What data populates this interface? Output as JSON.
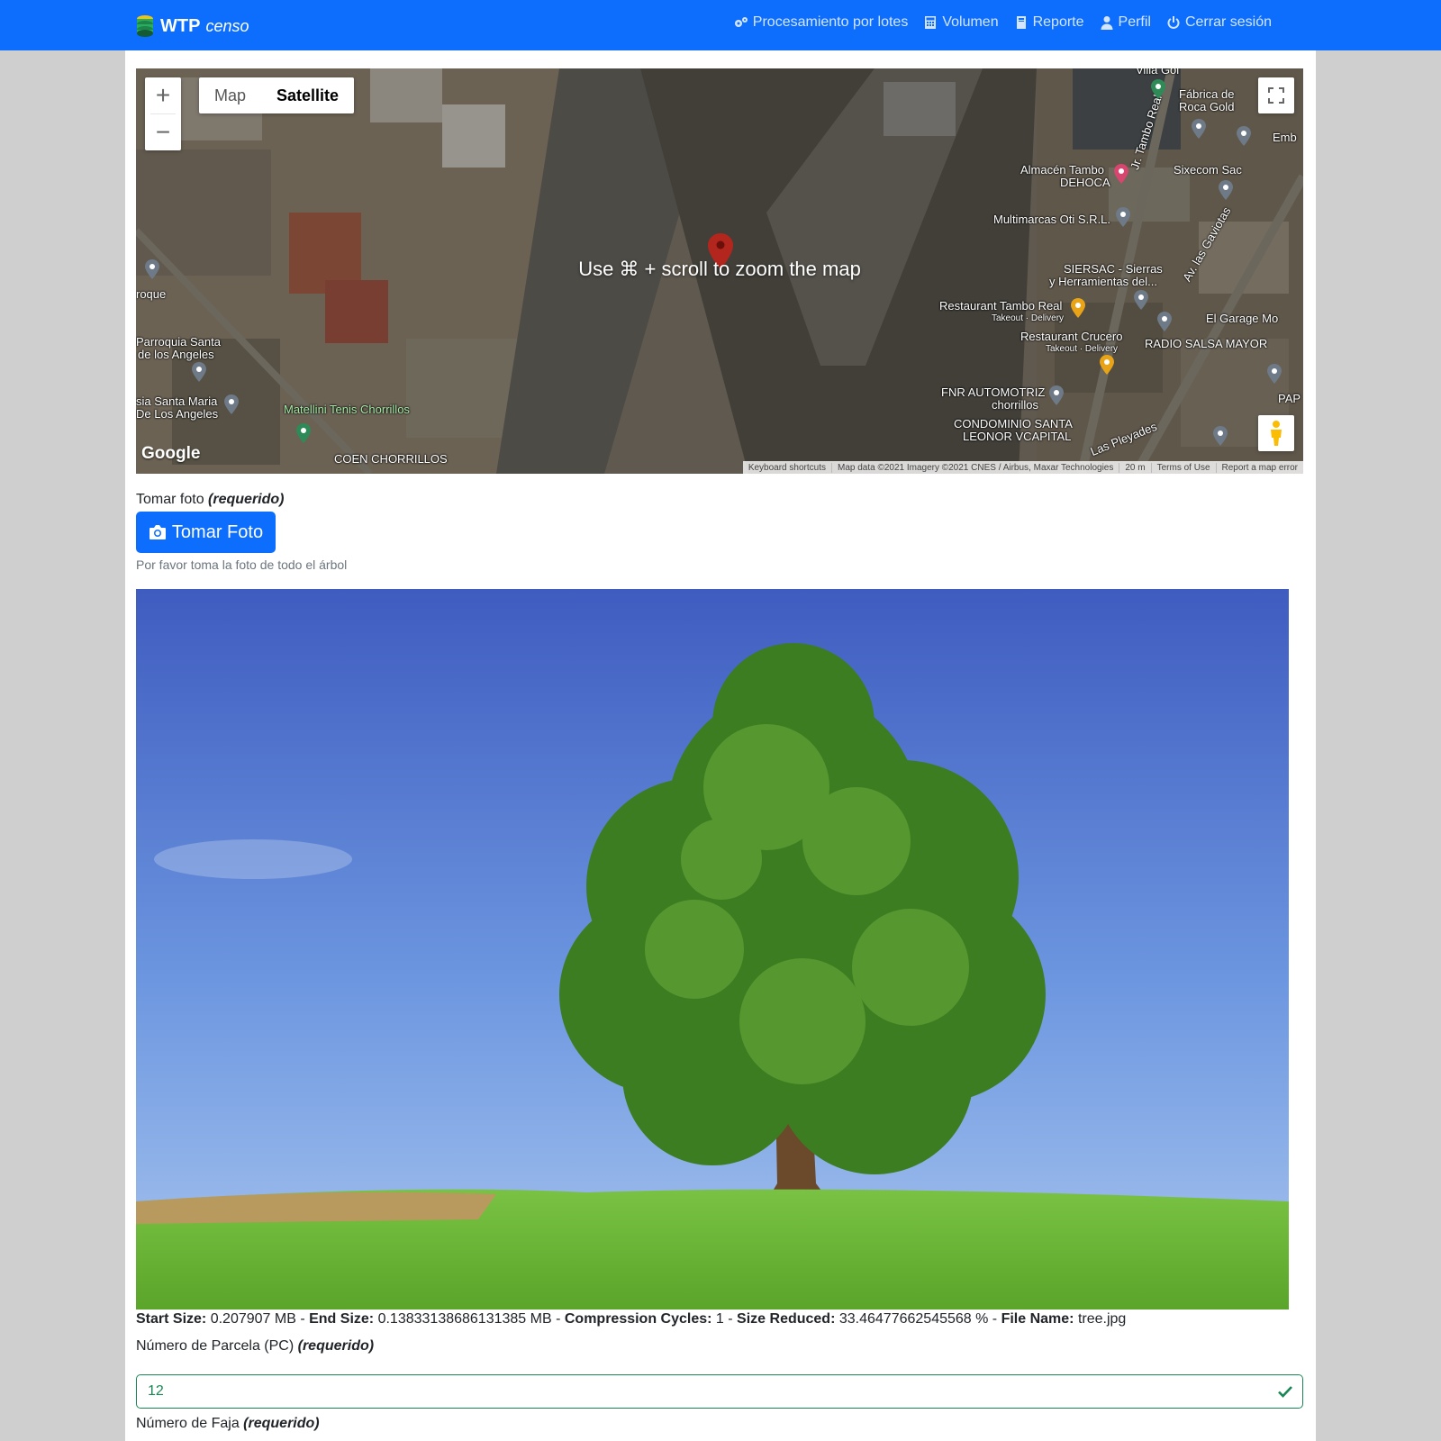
{
  "navbar": {
    "brand_strong": "WTP",
    "brand_em": "censo",
    "links": [
      {
        "label": "Procesamiento por lotes",
        "icon": "gears-icon"
      },
      {
        "label": "Volumen",
        "icon": "calculator-icon"
      },
      {
        "label": "Reporte",
        "icon": "book-icon"
      },
      {
        "label": "Perfil",
        "icon": "user-icon"
      },
      {
        "label": "Cerrar sesión",
        "icon": "power-icon"
      }
    ]
  },
  "map": {
    "type_map": "Map",
    "type_satellite": "Satellite",
    "selected_type": "Satellite",
    "zoom_in": "+",
    "zoom_out": "−",
    "scroll_hint": "Use ⌘ + scroll to zoom the map",
    "google": "Google",
    "attribution": {
      "shortcuts": "Keyboard shortcuts",
      "data": "Map data ©2021 Imagery ©2021 CNES / Airbus, Maxar Technologies",
      "scale": "20 m",
      "terms": "Terms of Use",
      "report": "Report a map error"
    },
    "pois": [
      "Villa Gol",
      "Fábrica de",
      "Roca Gold",
      "Emb",
      "Almacén Tambo",
      "DEHOCA",
      "Jr. Tambo Real",
      "Sixecom Sac",
      "Multimarcas Oti S.R.L.",
      "SIERSAC - Sierras",
      "y Herramientas del...",
      "Av. las Gaviotas",
      "Restaurant Tambo Real",
      "Takeout · Delivery",
      "El Garage Mo",
      "Restaurant Crucero",
      "Takeout · Delivery",
      "RADIO SALSA MAYOR",
      "FNR AUTOMOTRIZ",
      "chorrillos",
      "CONDOMINIO SANTA",
      "LEONOR VCAPITAL",
      "Las Pleyades",
      "PAP",
      "roque",
      "Parroquia Santa",
      "de los Angeles",
      "sia Santa Maria",
      "De Los Angeles",
      "Matellini Tenis Chorrillos",
      "COEN CHORRILLOS"
    ]
  },
  "form": {
    "photo_label": "Tomar foto",
    "required": "(requerido)",
    "photo_button": "Tomar Foto",
    "photo_help": "Por favor toma la foto de todo el árbol",
    "stats": {
      "start_label": "Start Size:",
      "start_value": "0.207907 MB",
      "end_label": "End Size:",
      "end_value": "0.13833138686131385 MB",
      "cycles_label": "Compression Cycles:",
      "cycles_value": "1",
      "reduced_label": "Size Reduced:",
      "reduced_value": "33.46477662545568 %",
      "file_label": "File Name:",
      "file_value": "tree.jpg",
      "sep": " - "
    },
    "parcela_label": "Número de Parcela (PC)",
    "parcela_value": "12",
    "faja_label": "Número de Faja"
  },
  "colors": {
    "primary": "#0d6efd",
    "valid": "#198754"
  }
}
